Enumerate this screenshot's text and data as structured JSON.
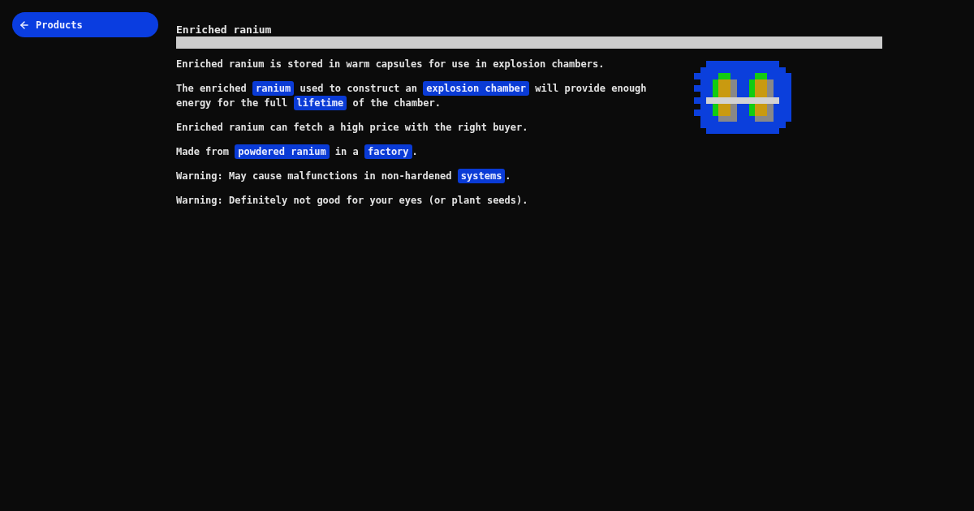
{
  "back_button": {
    "label": "Products"
  },
  "title": "Enriched ranium",
  "paragraphs": [
    {
      "parts": [
        {
          "kind": "text",
          "text": "Enriched ranium is stored in warm capsules for use in explosion chambers."
        }
      ]
    },
    {
      "parts": [
        {
          "kind": "text",
          "text": "The enriched "
        },
        {
          "kind": "link",
          "text": "ranium"
        },
        {
          "kind": "text",
          "text": " used to construct an "
        },
        {
          "kind": "link",
          "text": "explosion chamber"
        },
        {
          "kind": "text",
          "text": " will provide enough energy for the full "
        },
        {
          "kind": "link",
          "text": "lifetime"
        },
        {
          "kind": "text",
          "text": " of the chamber."
        }
      ]
    },
    {
      "parts": [
        {
          "kind": "text",
          "text": "Enriched ranium can fetch a high price with the right buyer."
        }
      ]
    },
    {
      "parts": [
        {
          "kind": "text",
          "text": "Made from "
        },
        {
          "kind": "link",
          "text": "powdered ranium"
        },
        {
          "kind": "text",
          "text": " in a "
        },
        {
          "kind": "link",
          "text": "factory"
        },
        {
          "kind": "text",
          "text": "."
        }
      ]
    },
    {
      "parts": [
        {
          "kind": "text",
          "text": "Warning: May cause malfunctions in non-hardened "
        },
        {
          "kind": "link",
          "text": "systems"
        },
        {
          "kind": "text",
          "text": "."
        }
      ]
    },
    {
      "parts": [
        {
          "kind": "text",
          "text": "Warning: Definitely not good for your eyes (or plant seeds)."
        }
      ]
    }
  ]
}
